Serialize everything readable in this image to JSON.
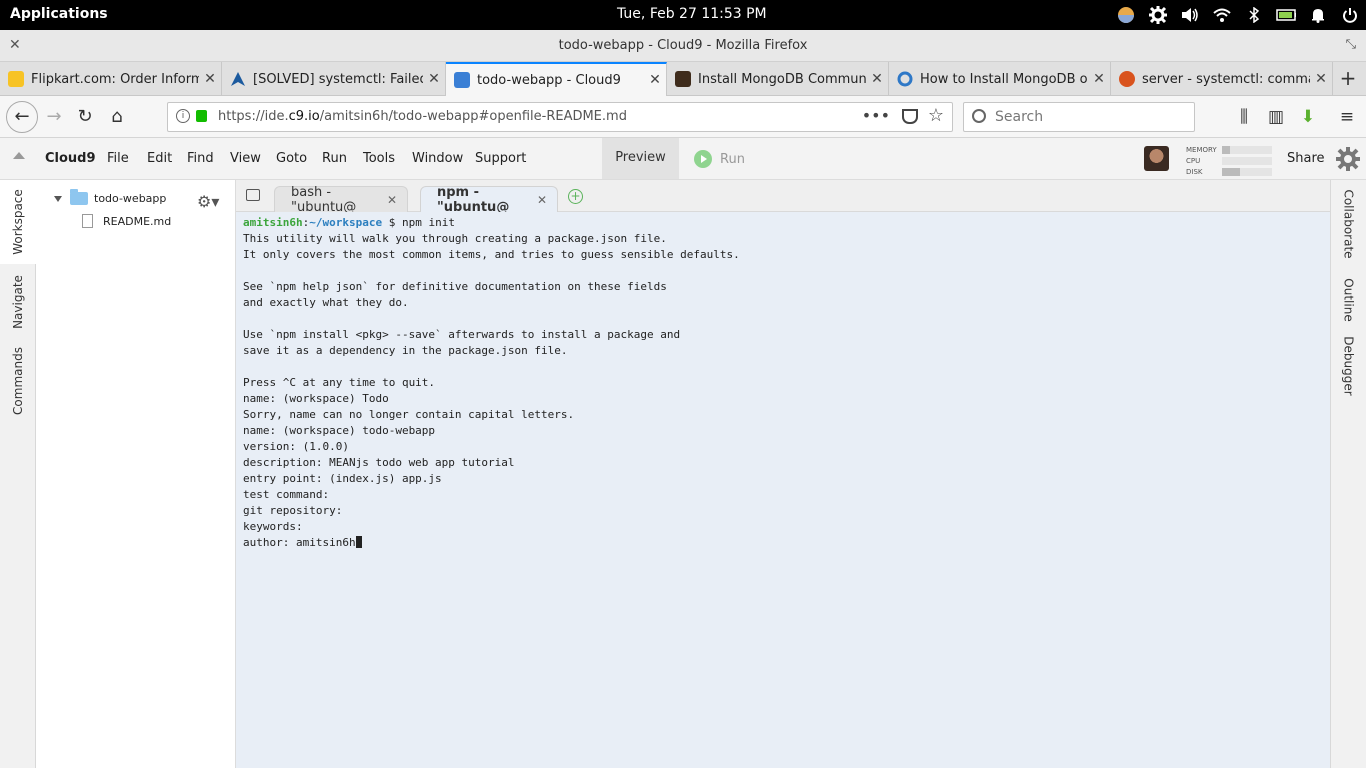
{
  "system_bar": {
    "applications": "Applications",
    "clock": "Tue, Feb 27   11:53 PM"
  },
  "window": {
    "title": "todo-webapp - Cloud9 - Mozilla Firefox"
  },
  "browser_tabs": [
    {
      "label": "Flipkart.com: Order Informati",
      "favicon_color": "#f7c325",
      "active": false
    },
    {
      "label": "[SOLVED] systemctl: Failed to",
      "favicon_color": "#1b5a9e",
      "active": false
    },
    {
      "label": "todo-webapp - Cloud9",
      "favicon_color": "#3a7fd5",
      "active": true
    },
    {
      "label": "Install MongoDB Community",
      "favicon_color": "#3f2c1c",
      "active": false
    },
    {
      "label": "How to Install MongoDB on U",
      "favicon_color": "#2e78c7",
      "active": false
    },
    {
      "label": "server - systemctl: command",
      "favicon_color": "#d9531e",
      "active": false
    }
  ],
  "navbar": {
    "url_prefix": "https://ide.",
    "url_host": "c9.io",
    "url_rest": "/amitsin6h/todo-webapp#openfile-README.md",
    "search_placeholder": "Search"
  },
  "c9_menu": {
    "brand": "Cloud9",
    "items": [
      "File",
      "Edit",
      "Find",
      "View",
      "Goto",
      "Run",
      "Tools",
      "Window",
      "Support"
    ],
    "preview": "Preview",
    "run": "Run",
    "share": "Share",
    "meters": [
      {
        "label": "MEMORY",
        "level": 0.15
      },
      {
        "label": "CPU",
        "level": 0.0
      },
      {
        "label": "DISK",
        "level": 0.35
      }
    ]
  },
  "left_panel_tabs": [
    "Workspace",
    "Navigate",
    "Commands"
  ],
  "right_panel_tabs": [
    "Collaborate",
    "Outline",
    "Debugger"
  ],
  "file_tree": {
    "folder": "todo-webapp",
    "files": [
      "README.md"
    ]
  },
  "terminal_tabs": [
    {
      "label": "bash - \"ubuntu@",
      "active": false
    },
    {
      "label": "npm - \"ubuntu@",
      "active": true
    }
  ],
  "terminal": {
    "prompt_user": "amitsin6h",
    "prompt_sep": ":",
    "prompt_path": "~/workspace",
    "prompt_cmd": " $ npm init",
    "lines": [
      "This utility will walk you through creating a package.json file.",
      "It only covers the most common items, and tries to guess sensible defaults.",
      "",
      "See `npm help json` for definitive documentation on these fields",
      "and exactly what they do.",
      "",
      "Use `npm install <pkg> --save` afterwards to install a package and",
      "save it as a dependency in the package.json file.",
      "",
      "Press ^C at any time to quit.",
      "name: (workspace) Todo",
      "Sorry, name can no longer contain capital letters.",
      "name: (workspace) todo-webapp",
      "version: (1.0.0)",
      "description: MEANjs todo web app tutorial",
      "entry point: (index.js) app.js",
      "test command:",
      "git repository:",
      "keywords:"
    ],
    "last_line": "author: amitsin6h"
  }
}
